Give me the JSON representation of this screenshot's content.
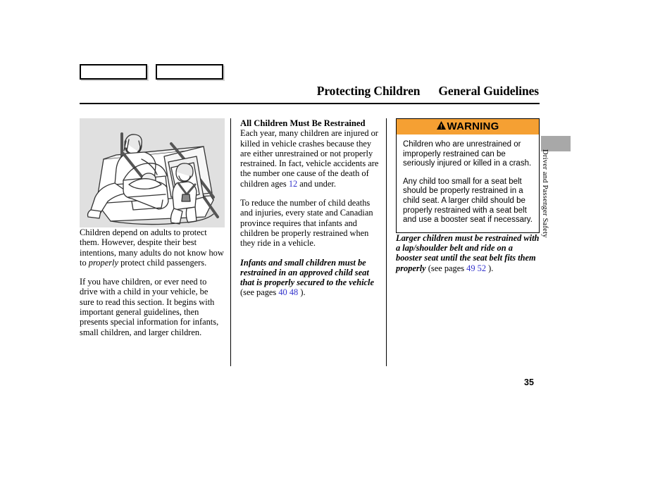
{
  "nav": {
    "buttons": [
      {
        "name": "nav-button-1",
        "label": ""
      },
      {
        "name": "nav-button-2",
        "label": ""
      }
    ]
  },
  "header": {
    "section_title": "Protecting Children",
    "subsection_title": "General Guidelines"
  },
  "left_column": {
    "illustration_alt": "Adult holding infant in a rear seat beside a child secured in a forward-facing child seat",
    "paragraphs": [
      {
        "pre": "Children depend on adults to protect them. However, despite their best intentions, many adults do not know how to ",
        "italic": "properly",
        "post": " protect child passengers."
      },
      {
        "pre": "If you have children, or ever need to drive with a child in your vehicle, be sure to read this section. It begins with important general guidelines, then presents special information for infants, small children, and larger children.",
        "italic": "",
        "post": ""
      }
    ]
  },
  "middle_column": {
    "heading": "All Children Must Be Restrained",
    "paragraph1_part1": "Each year, many children are injured or killed in vehicle crashes because they are either unrestrained or not properly restrained. In fact, vehicle accidents are the number one cause of the death of children ages ",
    "paragraph1_link": "12",
    "paragraph1_part2": " and under.",
    "paragraph2": "To reduce the number of child deaths and injuries, every state and Canadian province requires that infants and children be properly restrained when they ride in a vehicle.",
    "paragraph3_bold_italic": "Infants and small children must be restrained in an approved child seat that is properly secured to the vehicle",
    "paragraph3_see_pages": " (see pages ",
    "paragraph3_link1": "40",
    "paragraph3_sep": "  ",
    "paragraph3_link2": "48",
    "paragraph3_end": " )."
  },
  "right_column": {
    "warning": {
      "title": "WARNING",
      "icon": "warning-triangle-icon",
      "paragraphs": [
        "Children who are unrestrained or improperly restrained can be seriously injured or killed in a crash.",
        "Any child too small for a seat belt should be properly restrained in a child seat. A larger child should be properly restrained with a seat belt and use a booster seat if necessary."
      ],
      "header_color": "#f5a033"
    },
    "after_warning_bold_italic": "Larger children must be restrained with a lap/shoulder belt and ride on a booster seat until the seat belt fits them properly",
    "after_warning_see_pages": " (see pages ",
    "after_warning_link1": "49",
    "after_warning_sep": "  ",
    "after_warning_link2": "52",
    "after_warning_end": " )."
  },
  "edge_tab": {
    "label": "Driver and Passenger Safety",
    "color": "#a8a8a8"
  },
  "footer": {
    "page_number": "35"
  }
}
